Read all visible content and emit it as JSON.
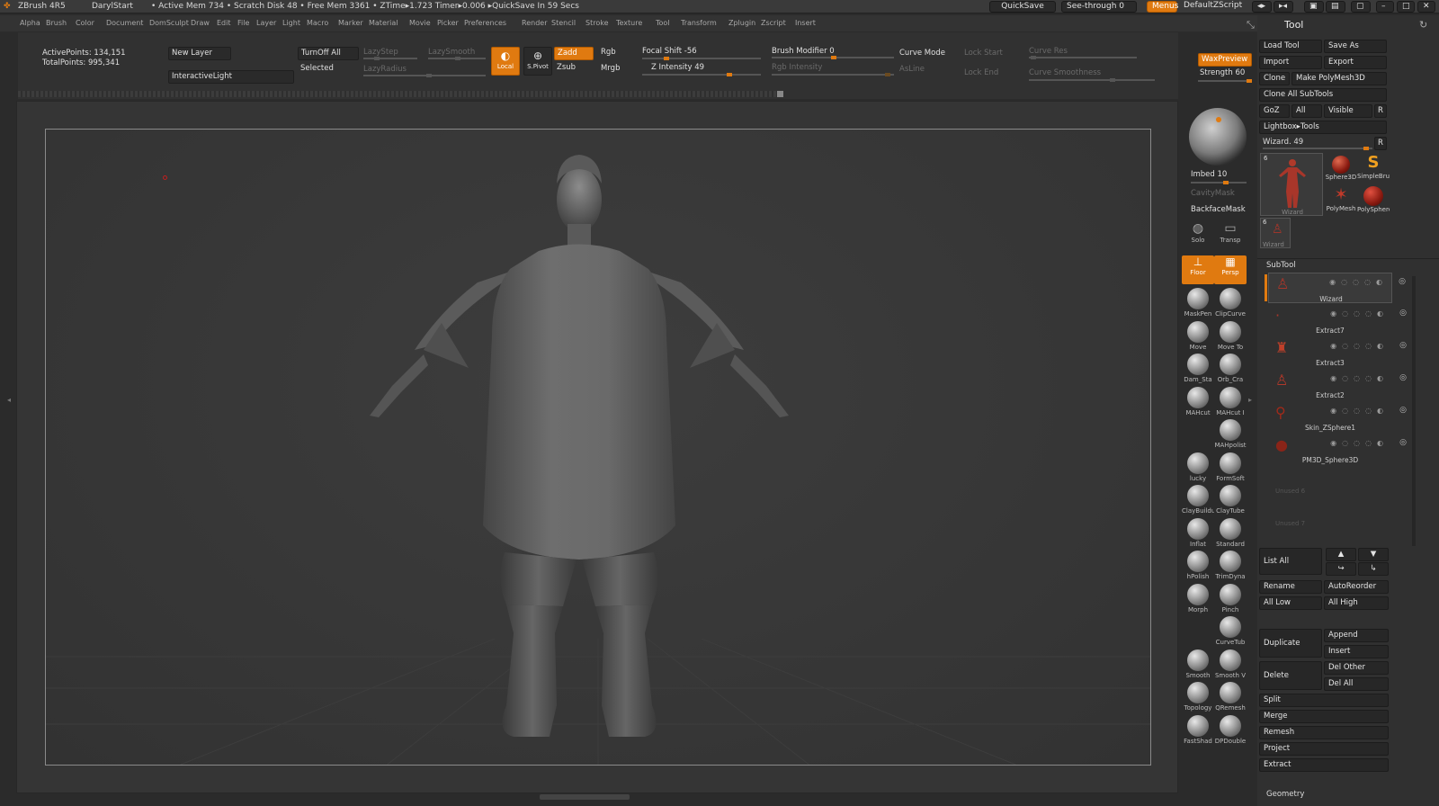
{
  "titlebar": {
    "app": "ZBrush 4R5",
    "doc": "DarylStart",
    "stats": "• Active Mem 734 • Scratch Disk 48 • Free Mem 3361 • ZTime▸1.723 Timer▸0.006 ▸QuickSave In 59 Secs",
    "quicksave": "QuickSave",
    "see_through": "See-through",
    "see_through_value": "0",
    "menus": "Menus",
    "script": "DefaultZScript"
  },
  "menu_items": [
    "Alpha",
    "Brush",
    "Color",
    "Document",
    "DomSculpt",
    "Draw",
    "Edit",
    "File",
    "Layer",
    "Light",
    "Macro",
    "Marker",
    "Material",
    "Movie",
    "Picker",
    "Preferences",
    "Render",
    "Stencil",
    "Stroke",
    "Texture",
    "Tool",
    "Transform",
    "Zplugin",
    "Zscript",
    "Insert"
  ],
  "shelf": {
    "active_points": "ActivePoints: 134,151",
    "total_points": "TotalPoints: 995,341",
    "new_layer": "New Layer",
    "interactive_light": "InteractiveLight",
    "turnoff_all": "TurnOff All",
    "selected": "Selected",
    "lazystep": "LazyStep",
    "lazysmooth": "LazySmooth",
    "lazyradius": "LazyRadius",
    "local": "Local",
    "spivot": "S.Pivot",
    "zadd": "Zadd",
    "zsub": "Zsub",
    "rgb": "Rgb",
    "mrgb": "Mrgb",
    "focal_shift": "Focal Shift -56",
    "z_intensity": "Z Intensity 49",
    "brush_modifier": "Brush Modifier 0",
    "rgb_intensity": "Rgb Intensity",
    "curve_mode": "Curve Mode",
    "asline": "AsLine",
    "lock_start": "Lock Start",
    "lock_end": "Lock End",
    "curve_res": "Curve Res",
    "curve_smoothness": "Curve Smoothness",
    "wax_preview": "WaxPreview",
    "strength": "Strength 60"
  },
  "rtools": {
    "imbed": "Imbed 10",
    "cavity_mask": "CavityMask",
    "backface_mask": "BackfaceMask",
    "solo": "Solo",
    "transp": "Transp",
    "floor": "Floor",
    "persp": "Persp",
    "brushes": [
      "MaskPen",
      "ClipCurve",
      "Move",
      "Move To",
      "Dam_Sta",
      "Orb_Cra",
      "MAHcut",
      "MAHcut I",
      "MAHpolist",
      "lucky",
      "FormSoft",
      "ClayBuildu",
      "ClayTube",
      "Inflat",
      "Standard",
      "hPolish",
      "TrimDyna",
      "Morph",
      "Pinch",
      "CurveTub",
      "Smooth",
      "Smooth V",
      "Topology",
      "QRemesh",
      "FastShad",
      "DPDouble"
    ]
  },
  "tool_panel": {
    "title": "Tool",
    "load_tool": "Load Tool",
    "save_as": "Save As",
    "import": "Import",
    "export": "Export",
    "clone": "Clone",
    "make_polymesh": "Make PolyMesh3D",
    "clone_all_subtools": "Clone All SubTools",
    "goz": "GoZ",
    "all": "All",
    "visible": "Visible",
    "r": "R",
    "lightbox_tools": "Lightbox▸Tools",
    "wizard_slider": "Wizard. 49",
    "thumb_main": "Wizard",
    "thumb_main_count": "6",
    "thumb_small": "Wizard",
    "thumb_small_count": "6",
    "thumbs": [
      "Sphere3D",
      "SimpleBrush",
      "PolyMesh",
      "PolySphere"
    ],
    "subtool_header": "SubTool",
    "subtools": [
      "Wizard",
      "Extract7",
      "Extract3",
      "Extract2",
      "Skin_ZSphere1",
      "PM3D_Sphere3D"
    ],
    "unused": [
      "Unused 6",
      "Unused 7"
    ],
    "list_all": "List All",
    "rename": "Rename",
    "auto_reorder": "AutoReorder",
    "all_low": "All Low",
    "all_high": "All High",
    "duplicate": "Duplicate",
    "append": "Append",
    "insert": "Insert",
    "delete": "Delete",
    "del_other": "Del Other",
    "del_all": "Del All",
    "split": "Split",
    "merge": "Merge",
    "remesh": "Remesh",
    "project": "Project",
    "extract": "Extract",
    "geometry": "Geometry"
  },
  "colors": {
    "accent": "#e07a10",
    "bg": "#2b2b2b",
    "panel": "#303030"
  }
}
